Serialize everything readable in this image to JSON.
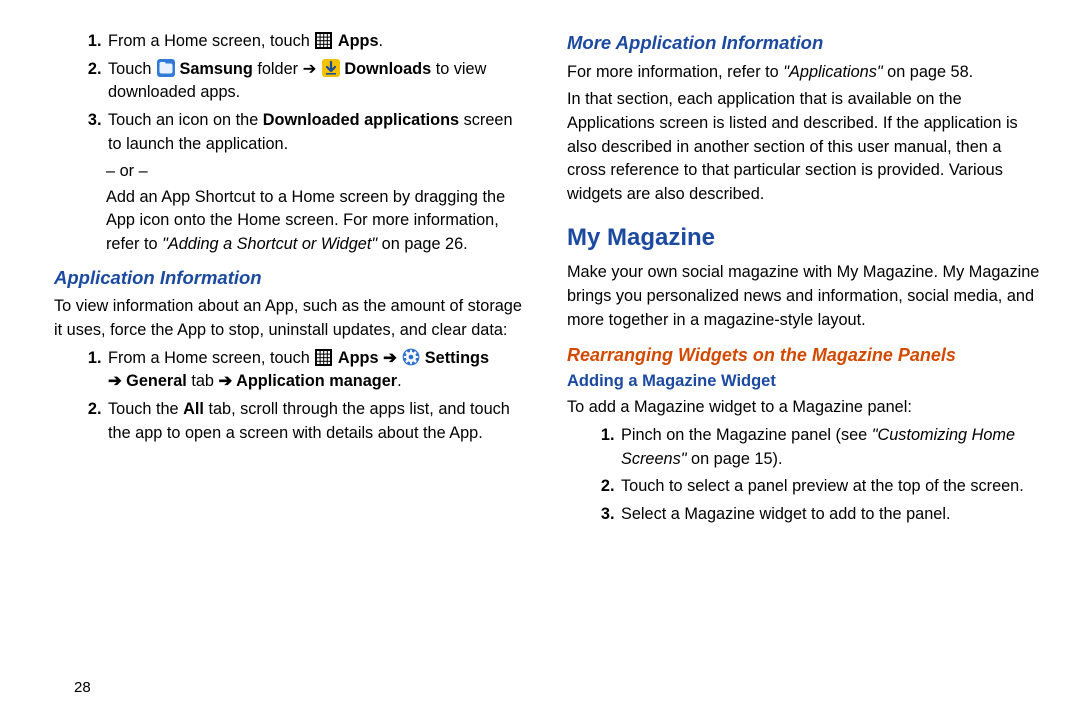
{
  "left": {
    "ol1": {
      "1_pre": "From a Home screen, touch ",
      "1_apps": "Apps",
      "1_post": ".",
      "2_pre": "Touch ",
      "2_samsung": "Samsung",
      "2_mid1": " folder ",
      "2_arrow1": "➔",
      "2_downloads": "Downloads",
      "2_post": " to view downloaded apps.",
      "3_pre": "Touch an icon on the ",
      "3_bold": "Downloaded applications",
      "3_post": " screen to launch the application."
    },
    "or": "– or –",
    "shortcut_a": "Add an App Shortcut to a Home screen by dragging the App icon onto the Home screen. For more information, refer to ",
    "shortcut_ital": "\"Adding a Shortcut or Widget\"",
    "shortcut_b": " on page 26.",
    "h2_appinfo": "Application Information",
    "appinfo_body": "To view information about an App, such as the amount of storage it uses, force the App to stop, uninstall updates, and clear data:",
    "ol2": {
      "1_pre": "From a Home screen, touch ",
      "1_apps": "Apps",
      "1_arrow1": " ➔ ",
      "1_settings": "Settings",
      "1_line2_arrow": "➔ ",
      "1_general": "General",
      "1_tab": " tab ",
      "1_arrow2": "➔ ",
      "1_appmgr": "Application manager",
      "1_end": ".",
      "2_a": "Touch the ",
      "2_all": "All",
      "2_b": " tab, scroll through the apps list, and touch the app to open a screen with details about the App."
    }
  },
  "right": {
    "h2_more": "More Application Information",
    "more_a": "For more information, refer to ",
    "more_ital": "\"Applications\"",
    "more_b": " on page 58.",
    "more_para": "In that section, each application that is available on the Applications screen is listed and described. If the application is also described in another section of this user manual, then a cross reference to that particular section is provided. Various widgets are also described.",
    "h1_mag": "My Magazine",
    "mag_body": "Make your own social magazine with My Magazine. My Magazine brings you personalized news and information, social media, and more together in a magazine-style layout.",
    "h3_rearr": "Rearranging Widgets on the Magazine Panels",
    "h4_add": "Adding a Magazine Widget",
    "add_body": "To add a Magazine widget to a Magazine panel:",
    "ol3": {
      "1_a": "Pinch on the Magazine panel (see ",
      "1_ital": "\"Customizing Home Screens\"",
      "1_b": " on page 15).",
      "2": "Touch to select a panel preview at the top of the screen.",
      "3": "Select a Magazine widget to add to the panel."
    }
  },
  "pagenum": "28"
}
